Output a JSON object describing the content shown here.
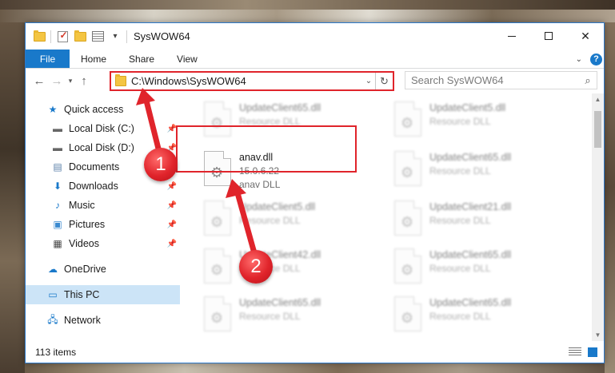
{
  "window": {
    "title": "SysWOW64",
    "controls": {
      "minimize": "—",
      "maximize": "□",
      "close": "✕"
    }
  },
  "ribbon": {
    "tabs": [
      "File",
      "Home",
      "Share",
      "View"
    ],
    "help": "?"
  },
  "address": {
    "path": "C:\\Windows\\SysWOW64",
    "search_placeholder": "Search SysWOW64"
  },
  "sidebar": {
    "items": [
      {
        "label": "Quick access",
        "icon": "star-icon",
        "pinned": false
      },
      {
        "label": "Local Disk (C:)",
        "icon": "drive-icon",
        "pinned": true
      },
      {
        "label": "Local Disk (D:)",
        "icon": "drive-icon",
        "pinned": true
      },
      {
        "label": "Documents",
        "icon": "documents-icon",
        "pinned": true
      },
      {
        "label": "Downloads",
        "icon": "download-icon",
        "pinned": true
      },
      {
        "label": "Music",
        "icon": "music-icon",
        "pinned": true
      },
      {
        "label": "Pictures",
        "icon": "pictures-icon",
        "pinned": true
      },
      {
        "label": "Videos",
        "icon": "videos-icon",
        "pinned": true
      },
      {
        "label": "OneDrive",
        "icon": "cloud-icon",
        "pinned": false
      },
      {
        "label": "This PC",
        "icon": "computer-icon",
        "pinned": false,
        "selected": true
      },
      {
        "label": "Network",
        "icon": "network-icon",
        "pinned": false
      }
    ]
  },
  "files": [
    {
      "name": "UpdateClient65.dll",
      "type": "Resource DLL",
      "blurred": true
    },
    {
      "name": "UpdateClient5.dll",
      "type": "Resource DLL",
      "blurred": true
    },
    {
      "name": "anav.dll",
      "version": "15.0.6.22",
      "type": "anav DLL",
      "blurred": false
    },
    {
      "name": "UpdateClient65.dll",
      "type": "Resource DLL",
      "blurred": true
    },
    {
      "name": "UpdateClient5.dll",
      "type": "Resource DLL",
      "blurred": true
    },
    {
      "name": "UpdateClient21.dll",
      "type": "Resource DLL",
      "blurred": true
    },
    {
      "name": "UpdateClient42.dll",
      "type": "Resource DLL",
      "blurred": true
    },
    {
      "name": "UpdateClient65.dll",
      "type": "Resource DLL",
      "blurred": true
    },
    {
      "name": "UpdateClient65.dll",
      "type": "Resource DLL",
      "blurred": true
    },
    {
      "name": "UpdateClient65.dll",
      "type": "Resource DLL",
      "blurred": true
    }
  ],
  "status": {
    "count": "113 items"
  },
  "callouts": {
    "one": "1",
    "two": "2"
  },
  "colors": {
    "accent": "#1979ca",
    "highlight": "#e0242b",
    "selected": "#cce4f7"
  }
}
